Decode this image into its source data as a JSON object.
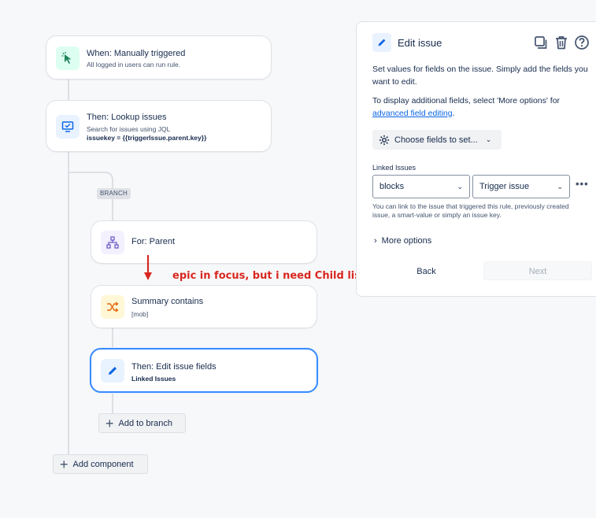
{
  "flow": {
    "trigger": {
      "title": "When: Manually triggered",
      "subtitle": "All logged in users can run rule."
    },
    "lookup": {
      "title": "Then: Lookup issues",
      "subtitle": "Search for issues using JQL",
      "jql": "issuekey = {{triggerIssue.parent.key}}"
    },
    "branch_tag": "BRANCH",
    "for_parent": {
      "title": "For: Parent"
    },
    "condition": {
      "title": "Summary contains",
      "subtitle": "[mob]"
    },
    "edit_action": {
      "title": "Then: Edit issue fields",
      "subtitle": "Linked Issues"
    },
    "add_to_branch": "Add to branch",
    "add_component": "Add component"
  },
  "annotation": {
    "text": "epic in focus, but i need Child list",
    "color": "#d7261f"
  },
  "panel": {
    "title": "Edit issue",
    "description": "Set values for fields on the issue. Simply add the fields you want to edit.",
    "additional_prefix": "To display additional fields, select 'More options' for",
    "advanced_link": "advanced field editing",
    "additional_suffix": ".",
    "choose_fields": "Choose fields to set...",
    "linked_label": "Linked Issues",
    "link_type": "blocks",
    "link_target": "Trigger issue",
    "help_text": "You can link to the issue that triggered this rule, previously created issue, a smart-value or simply an issue key.",
    "more_options": "More options",
    "back": "Back",
    "next": "Next"
  },
  "colors": {
    "accent": "#0c66e4",
    "selected_border": "#388bff",
    "trigger_icon_bg": "#dcfff1",
    "lookup_icon_bg": "#e9f2ff",
    "branch_icon_bg": "#f3f0ff",
    "condition_icon_bg": "#fff7d6"
  }
}
